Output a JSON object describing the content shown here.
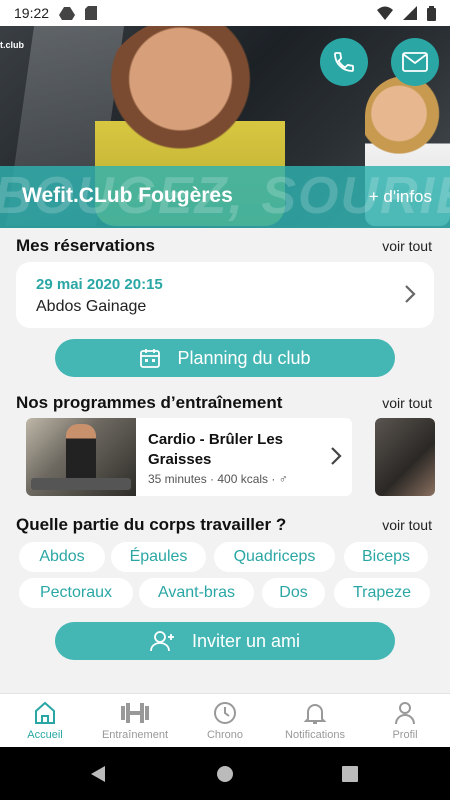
{
  "status_bar": {
    "time": "19:22"
  },
  "header": {
    "logo_text": "t.club",
    "club_name": "Wefit.CLub Fougères",
    "infos_link": "+ d'infos",
    "watermark": "BOUGEZ, SOURIEZ",
    "phone_icon": "phone-icon",
    "mail_icon": "mail-icon"
  },
  "reservations": {
    "title": "Mes réservations",
    "see_all": "voir tout",
    "item": {
      "date": "29 mai 2020 20:15",
      "name": "Abdos Gainage"
    }
  },
  "planning_button": {
    "label": "Planning du club",
    "icon": "calendar-icon"
  },
  "programs": {
    "title": "Nos programmes d’entraînement",
    "see_all": "voir tout",
    "item": {
      "title": "Cardio - Brûler Les Graisses",
      "meta": "35 minutes · 400 kcals · ♂"
    }
  },
  "body_parts": {
    "title": "Quelle partie du corps travailler ?",
    "see_all": "voir tout",
    "chips": [
      "Abdos",
      "Épaules",
      "Quadriceps",
      "Biceps",
      "Pectoraux",
      "Avant-bras",
      "Dos",
      "Trapeze"
    ]
  },
  "invite_button": {
    "label": "Inviter un ami",
    "icon": "add-user-icon"
  },
  "bottom_nav": {
    "items": [
      {
        "label": "Accueil",
        "icon": "home-icon",
        "active": true
      },
      {
        "label": "Entraînement",
        "icon": "dumbbell-icon",
        "active": false
      },
      {
        "label": "Chrono",
        "icon": "clock-icon",
        "active": false
      },
      {
        "label": "Notifications",
        "icon": "bell-icon",
        "active": false
      },
      {
        "label": "Profil",
        "icon": "user-icon",
        "active": false
      }
    ]
  },
  "colors": {
    "accent": "#2aa7a5",
    "button": "#44b7b5",
    "background": "#f2f2f2"
  }
}
